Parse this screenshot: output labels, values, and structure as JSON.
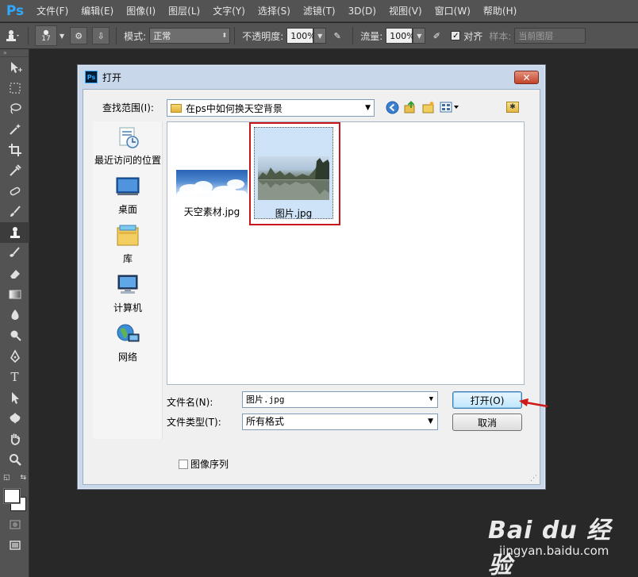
{
  "app": {
    "logo": "Ps",
    "menu": [
      "文件(F)",
      "编辑(E)",
      "图像(I)",
      "图层(L)",
      "文字(Y)",
      "选择(S)",
      "滤镜(T)",
      "3D(D)",
      "视图(V)",
      "窗口(W)",
      "帮助(H)"
    ]
  },
  "options": {
    "brush_size": "17",
    "mode_label": "模式:",
    "mode_value": "正常",
    "opacity_label": "不透明度:",
    "opacity_value": "100%",
    "flow_label": "流量:",
    "flow_value": "100%",
    "align_label": "对齐",
    "sample_label": "样本:",
    "sample_value": "当前图层"
  },
  "dialog": {
    "title": "打开",
    "close_glyph": "✕",
    "look_in_label": "查找范围(I):",
    "look_in_value": "在ps中如何换天空背景",
    "places": [
      {
        "label": "最近访问的位置",
        "icon": "recent-places-icon"
      },
      {
        "label": "桌面",
        "icon": "desktop-icon"
      },
      {
        "label": "库",
        "icon": "libraries-icon"
      },
      {
        "label": "计算机",
        "icon": "computer-icon"
      },
      {
        "label": "网络",
        "icon": "network-icon"
      }
    ],
    "files": [
      {
        "name": "天空素材.jpg",
        "selected": false
      },
      {
        "name": "图片.jpg",
        "selected": true
      }
    ],
    "file_name_label": "文件名(N):",
    "file_name_value": "图片.jpg",
    "file_type_label": "文件类型(T):",
    "file_type_value": "所有格式",
    "open_button": "打开(O)",
    "cancel_button": "取消",
    "image_sequence_label": "图像序列",
    "image_sequence_checked": false
  },
  "watermark": {
    "brand": "Bai du 经验",
    "url": "jingyan.baidu.com"
  },
  "colors": {
    "ps_blue": "#31a8ff",
    "highlight_red": "#c8171c",
    "panel_gray": "#535353"
  }
}
